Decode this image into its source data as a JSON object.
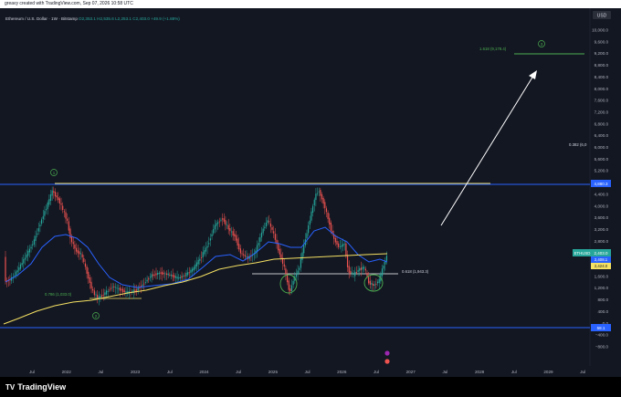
{
  "topbar": {
    "text": "greavy created with TradingView.com, Sep 07, 2026 10:58 UTC"
  },
  "legend": {
    "symbol": "Ethereum / U.S. Dollar · 1W · Bitstamp",
    "ohlc": "O2,353.1 H2,535.6 L2,253.1 C2,403.0 +49.9 (+1.88%)"
  },
  "currency": "USD",
  "price_axis": [
    "10,000.0",
    "9,600.0",
    "9,200.0",
    "8,800.0",
    "8,400.0",
    "8,000.0",
    "7,600.0",
    "7,200.0",
    "6,800.0",
    "6,400.0",
    "6,000.0",
    "5,600.0",
    "5,200.0",
    "4,800.0",
    "4,400.0",
    "4,000.0",
    "3,600.0",
    "3,200.0",
    "2,800.0",
    "2,400.0",
    "2,000.0",
    "1,600.0",
    "1,200.0",
    "800.0",
    "400.0",
    "0.0",
    "−400.0",
    "−800.0"
  ],
  "time_axis": [
    "Jul",
    "2022",
    "Jul",
    "2023",
    "Jul",
    "2024",
    "Jul",
    "2025",
    "Jul",
    "2026",
    "Jul",
    "2027",
    "Jul",
    "2028",
    "Jul",
    "2029",
    "Jul"
  ],
  "badges": {
    "top_line": "4,880.3",
    "bottom_line": "58.1",
    "symbol": "ETHUSD",
    "price": "2,403.0",
    "sub1": "2,408.1",
    "sub2": "2,424.0"
  },
  "annotations": {
    "fib_low": "0.786 (1,033.0)",
    "fib_mid": "0.618 (1,943.3)",
    "fib_target": "1.618 (9,178.4)",
    "fib_right": "0.382 (6,0",
    "wave1": "1",
    "wave2": "2",
    "wave3": "3"
  },
  "brand": {
    "name": "TradingView",
    "mark": "TV"
  },
  "colors": {
    "bg": "#131722",
    "up": "#26a69a",
    "down": "#ef5350",
    "ma_blue": "#2962ff",
    "ma_yellow": "#f5e163",
    "hline_blue": "#2962ff",
    "green_label": "#4caf50"
  }
}
